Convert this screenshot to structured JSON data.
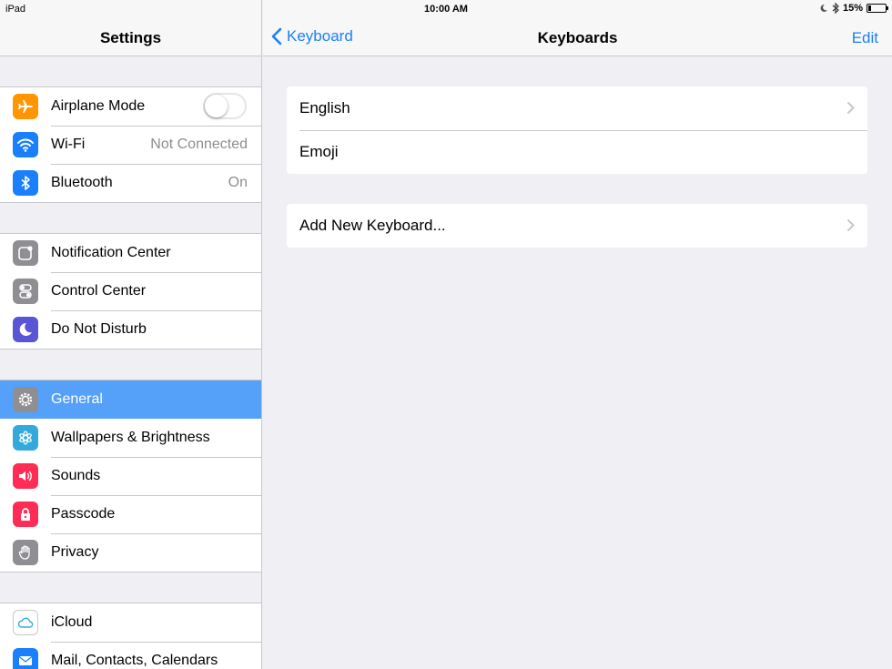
{
  "status": {
    "device": "iPad",
    "time": "10:00 AM",
    "battery": "15%",
    "battery_level": 0.15
  },
  "sidebar": {
    "title": "Settings",
    "groups": [
      [
        {
          "label": "Airplane Mode",
          "icon": "airplane-icon",
          "color": "#ff9500",
          "toggle": false
        },
        {
          "label": "Wi-Fi",
          "icon": "wifi-icon",
          "color": "#1a7ffb",
          "value": "Not Connected"
        },
        {
          "label": "Bluetooth",
          "icon": "bluetooth-icon",
          "color": "#1a7ffb",
          "value": "On"
        }
      ],
      [
        {
          "label": "Notification Center",
          "icon": "notification-center-icon",
          "color": "#8e8e93"
        },
        {
          "label": "Control Center",
          "icon": "control-center-icon",
          "color": "#8e8e93"
        },
        {
          "label": "Do Not Disturb",
          "icon": "moon-icon",
          "color": "#5856d6"
        }
      ],
      [
        {
          "label": "General",
          "icon": "gear-icon",
          "color": "#8e8e93",
          "selected": true
        },
        {
          "label": "Wallpapers & Brightness",
          "icon": "flower-icon",
          "color": "#34aadc"
        },
        {
          "label": "Sounds",
          "icon": "speaker-icon",
          "color": "#ff2d55"
        },
        {
          "label": "Passcode",
          "icon": "lock-icon",
          "color": "#ff2d55"
        },
        {
          "label": "Privacy",
          "icon": "hand-icon",
          "color": "#8e8e93"
        }
      ],
      [
        {
          "label": "iCloud",
          "icon": "cloud-icon",
          "color": "#fff"
        },
        {
          "label": "Mail, Contacts, Calendars",
          "icon": "mail-icon",
          "color": "#1a7ffb"
        }
      ]
    ]
  },
  "detail": {
    "back_label": "Keyboard",
    "title": "Keyboards",
    "edit_label": "Edit",
    "keyboards": [
      "English",
      "Emoji"
    ],
    "add_label": "Add New Keyboard..."
  },
  "colors": {
    "accent": "#1a7ffb",
    "selected": "#55a0f9"
  }
}
